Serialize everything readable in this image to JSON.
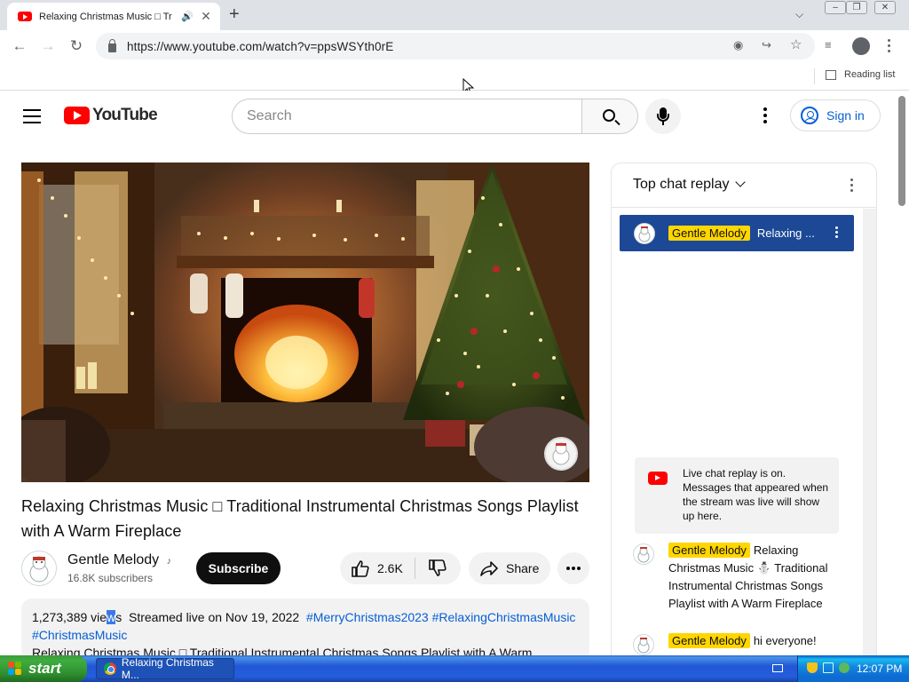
{
  "browser": {
    "tab_title": "Relaxing Christmas Music □ Tr",
    "tab_audio_icon": "speaker-icon",
    "url": "https://www.youtube.com/watch?v=ppsWSYth0rE",
    "reading_list_label": "Reading list"
  },
  "youtube": {
    "logo_text": "YouTube",
    "search_placeholder": "Search",
    "signin_label": "Sign in",
    "video": {
      "title": "Relaxing Christmas Music □ Traditional Instrumental Christmas Songs Playlist with A Warm Fireplace",
      "channel_name": "Gentle Melody",
      "channel_badge": "♪",
      "subscribers": "16.8K subscribers",
      "subscribe_label": "Subscribe",
      "likes": "2.6K",
      "share_label": "Share",
      "description": {
        "views_a": "1,273,389 vie",
        "views_hl": "w",
        "views_b": "s",
        "streamed": "Streamed live on Nov 19, 2022",
        "tag1": "#MerryChristmas2023",
        "tag2": "#RelaxingChristmasMusic",
        "tag3": "#ChristmasMusic",
        "snippet": "Relaxing Christmas Music □ Traditional Instrumental Christmas Songs Playlist with A Warm"
      }
    },
    "chat": {
      "mode_label": "Top chat replay",
      "pinned": {
        "author": "Gentle Melody",
        "text": "Relaxing ..."
      },
      "replay_notice": "Live chat replay is on. Messages that appeared when the stream was live will show up here.",
      "messages": [
        {
          "author": "Gentle Melody",
          "text": "Relaxing Christmas Music ⛄ Traditional Instrumental Christmas Songs Playlist with A Warm Fireplace"
        },
        {
          "author": "Gentle Melody",
          "text": "hi everyone!"
        }
      ]
    }
  },
  "taskbar": {
    "start_label": "start",
    "task_label": "Relaxing Christmas M...",
    "clock": "12:07 PM"
  },
  "colors": {
    "youtube_red": "#ff0000",
    "link_blue": "#065fd4",
    "owner_badge": "#ffd600",
    "pinned_bg": "#1c4896",
    "xp_taskbar": "#245edb",
    "xp_start_green": "#3fad3f"
  }
}
